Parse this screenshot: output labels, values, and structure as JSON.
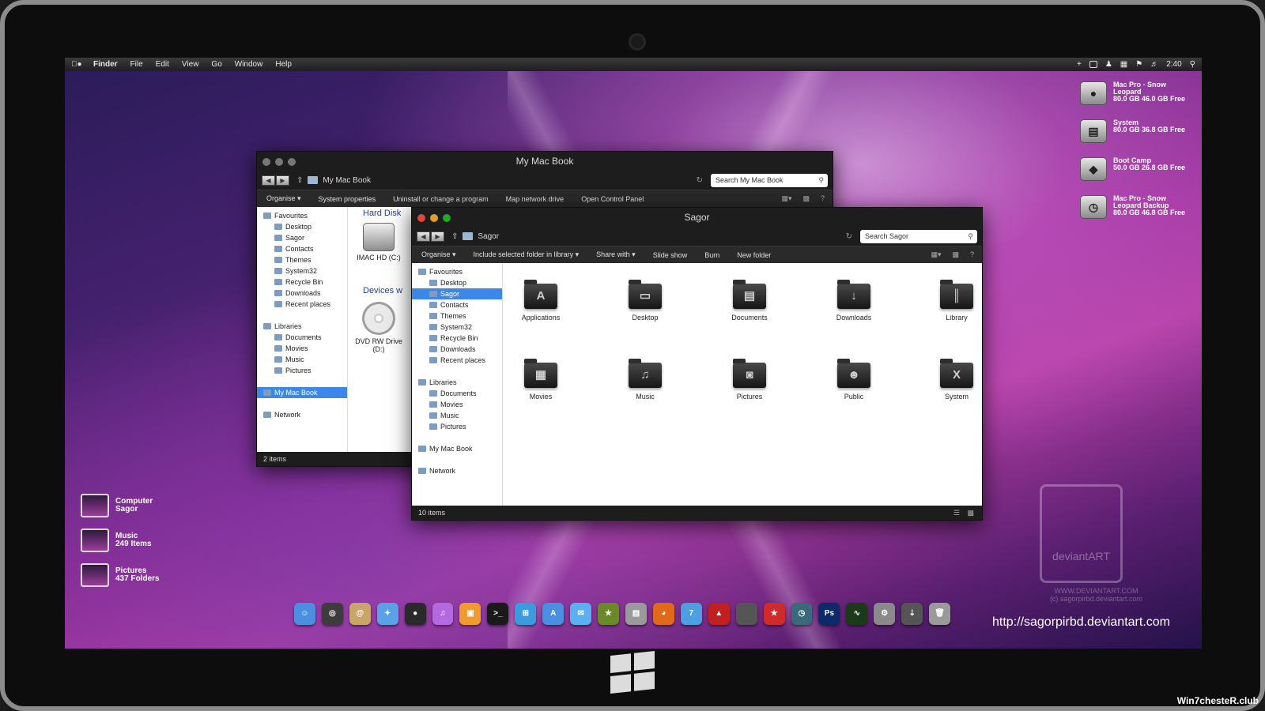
{
  "menubar": {
    "app": "Finder",
    "items": [
      "File",
      "Edit",
      "View",
      "Go",
      "Window",
      "Help"
    ],
    "clock": "2:40"
  },
  "drives": [
    {
      "line1": "Mac Pro - Snow",
      "line2": "Leopard",
      "line3": "80.0 GB 46.0 GB Free",
      "icon": "apple-drive-icon"
    },
    {
      "line1": "System",
      "line2": "80.0 GB 36.8 GB Free",
      "line3": "",
      "icon": "hard-drive-icon"
    },
    {
      "line1": "Boot Camp",
      "line2": "50.0 GB 26.8 GB Free",
      "line3": "",
      "icon": "bootcamp-drive-icon"
    },
    {
      "line1": "Mac Pro - Snow",
      "line2": "Leopard Backup",
      "line3": "80.0 GB 46.8 GB Free",
      "icon": "timemachine-drive-icon"
    }
  ],
  "desktop_items": [
    {
      "line1": "Computer",
      "line2": "Sagor"
    },
    {
      "line1": "Music",
      "line2": "249 Items"
    },
    {
      "line1": "Pictures",
      "line2": "437 Folders"
    }
  ],
  "win_back": {
    "title": "My Mac Book",
    "breadcrumb": "My Mac Book",
    "search_placeholder": "Search My Mac Book",
    "toolbar": [
      "Organise ▾",
      "System properties",
      "Uninstall or change a program",
      "Map network drive",
      "Open Control Panel"
    ],
    "nav": {
      "favourites": "Favourites",
      "fav_items": [
        "Desktop",
        "Sagor",
        "Contacts",
        "Themes",
        "System32",
        "Recycle Bin",
        "Downloads",
        "Recent places"
      ],
      "libraries": "Libraries",
      "lib_items": [
        "Documents",
        "Movies",
        "Music",
        "Pictures"
      ],
      "computer": "My Mac Book",
      "network": "Network"
    },
    "section_hdd": "Hard Disk",
    "section_dev": "Devices w",
    "hdd_label": "IMAC HD (C:)",
    "dvd_label": "DVD RW Drive (D:)",
    "status": "2 items"
  },
  "win_front": {
    "title": "Sagor",
    "breadcrumb": "Sagor",
    "search_placeholder": "Search Sagor",
    "toolbar": [
      "Organise ▾",
      "Include selected folder in library ▾",
      "Share with ▾",
      "Slide show",
      "Burn",
      "New folder"
    ],
    "nav": {
      "favourites": "Favourites",
      "fav_items": [
        "Desktop",
        "Sagor",
        "Contacts",
        "Themes",
        "System32",
        "Recycle Bin",
        "Downloads",
        "Recent places"
      ],
      "libraries": "Libraries",
      "lib_items": [
        "Documents",
        "Movies",
        "Music",
        "Pictures"
      ],
      "computer": "My Mac Book",
      "network": "Network"
    },
    "folders": [
      {
        "label": "Applications",
        "glyph": "A"
      },
      {
        "label": "Desktop",
        "glyph": "▭"
      },
      {
        "label": "Documents",
        "glyph": "▤"
      },
      {
        "label": "Downloads",
        "glyph": "↓"
      },
      {
        "label": "Library",
        "glyph": "║"
      },
      {
        "label": "Movies",
        "glyph": "▦"
      },
      {
        "label": "Music",
        "glyph": "♫"
      },
      {
        "label": "Pictures",
        "glyph": "◙"
      },
      {
        "label": "Public",
        "glyph": "☻"
      },
      {
        "label": "System",
        "glyph": "X"
      }
    ],
    "status": "10 items"
  },
  "dock": [
    {
      "name": "finder",
      "color": "#4b8fe0",
      "glyph": "☺"
    },
    {
      "name": "dashboard",
      "color": "#3c3c3c",
      "glyph": "◎"
    },
    {
      "name": "address-book",
      "color": "#c9a56a",
      "glyph": "@"
    },
    {
      "name": "safari",
      "color": "#5aa2e8",
      "glyph": "✦"
    },
    {
      "name": "camera",
      "color": "#2a2a2a",
      "glyph": "●"
    },
    {
      "name": "itunes",
      "color": "#b36ae0",
      "glyph": "♫"
    },
    {
      "name": "ipod",
      "color": "#f39a2c",
      "glyph": "▣"
    },
    {
      "name": "terminal",
      "color": "#1a1a1a",
      "glyph": ">_"
    },
    {
      "name": "windows",
      "color": "#3b9be0",
      "glyph": "⊞"
    },
    {
      "name": "app-store",
      "color": "#4a90e2",
      "glyph": "A"
    },
    {
      "name": "mail",
      "color": "#5ab0f0",
      "glyph": "✉"
    },
    {
      "name": "messenger",
      "color": "#6a8a2a",
      "glyph": "★"
    },
    {
      "name": "preview",
      "color": "#9a9a9a",
      "glyph": "▤"
    },
    {
      "name": "firefox",
      "color": "#e06a1a",
      "glyph": "◕"
    },
    {
      "name": "windows-7",
      "color": "#4aa0e0",
      "glyph": "7"
    },
    {
      "name": "pdf",
      "color": "#c02020",
      "glyph": "▲"
    },
    {
      "name": "blank-app",
      "color": "#555555",
      "glyph": ""
    },
    {
      "name": "star-app",
      "color": "#d02a2a",
      "glyph": "★"
    },
    {
      "name": "time-machine",
      "color": "#3a6a7a",
      "glyph": "◷"
    },
    {
      "name": "photoshop",
      "color": "#0a2a6a",
      "glyph": "Ps"
    },
    {
      "name": "activity-monitor",
      "color": "#1a3a1a",
      "glyph": "∿"
    },
    {
      "name": "system-preferences",
      "color": "#8a8a8a",
      "glyph": "⚙"
    },
    {
      "name": "downloads-stack",
      "color": "#555555",
      "glyph": "⇣"
    },
    {
      "name": "trash",
      "color": "#9a9a9a",
      "glyph": "🗑"
    }
  ],
  "watermark": {
    "brand": "deviantART",
    "line1": "WWW.DEVIANTART.COM",
    "line2": "(c) sagorpirbd.deviantart.com"
  },
  "url_text": "http://sagorpirbd.deviantart.com",
  "corner_text": "Win7chesteR.club"
}
